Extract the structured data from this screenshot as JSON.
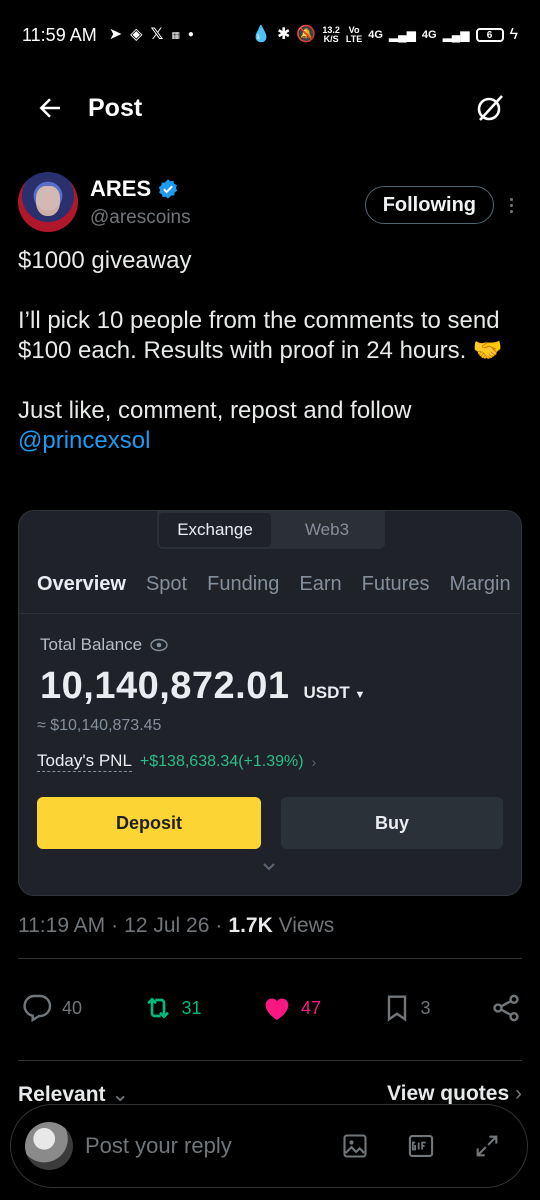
{
  "status_bar": {
    "time": "11:59 AM",
    "net_speed_top": "13.2",
    "net_speed_bottom": "K/S",
    "volte_top": "Vo",
    "volte_bottom": "LTE",
    "net_1": "4G",
    "net_2": "4G",
    "battery": "6"
  },
  "header": {
    "title": "Post"
  },
  "author": {
    "display_name": "ARES",
    "handle": "@arescoins",
    "follow_label": "Following"
  },
  "post": {
    "line1": "$1000 giveaway",
    "line2": "I’ll pick 10 people from the comments to send $100 each. Results with proof in 24 hours. 🤝",
    "line3": "Just like, comment, repost and follow",
    "mention": "@princexsol"
  },
  "media": {
    "segments": [
      "Exchange",
      "Web3"
    ],
    "tabs": [
      "Overview",
      "Spot",
      "Funding",
      "Earn",
      "Futures",
      "Margin"
    ],
    "balance_label": "Total Balance",
    "balance_value": "10,140,872.01",
    "balance_unit": "USDT",
    "balance_approx": "≈ $10,140,873.45",
    "pnl_label": "Today's PNL",
    "pnl_value": "+$138,638.34(+1.39%)",
    "deposit_label": "Deposit",
    "buy_label": "Buy"
  },
  "meta": {
    "time": "11:19 AM",
    "date": "12 Jul 26",
    "views_count": "1.7K",
    "views_label": "Views"
  },
  "actions": {
    "replies": "40",
    "reposts": "31",
    "likes": "47",
    "bookmarks": "3"
  },
  "sort": {
    "relevant_label": "Relevant",
    "quotes_label": "View quotes"
  },
  "reply": {
    "placeholder": "Post your reply"
  },
  "colors": {
    "accent_blue": "#1d9bf0",
    "repost_green": "#00ba7c",
    "like_pink": "#f91880",
    "binance_yellow": "#fcd535",
    "pnl_green": "#2ebd85"
  }
}
